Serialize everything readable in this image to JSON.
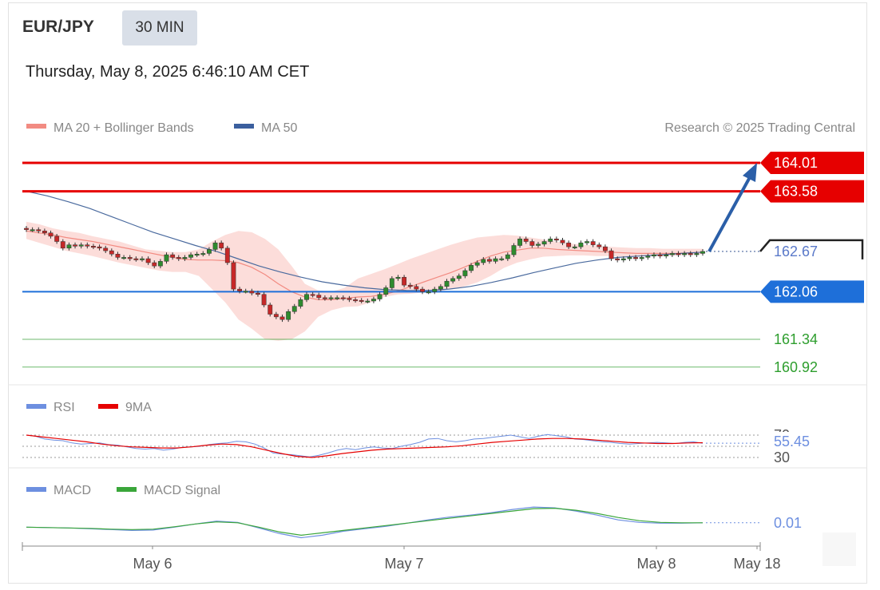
{
  "header": {
    "symbol": "EUR/JPY",
    "timeframe": "30 MIN",
    "datetime": "Thursday, May 8, 2025 6:46:10 AM CET"
  },
  "colors": {
    "resistance": "#e60000",
    "pivot": "#1e6fd9",
    "support": "#2e9e2e",
    "ma20": "#f28b82",
    "band_fill": "#fcd7d4",
    "ma50": "#4a6a9e",
    "arrow": "#2b5fa8",
    "candle_up": "#2e8b2e",
    "candle_down": "#c62828",
    "rsi": "#6d8fe0",
    "rsi_ma": "#e60000",
    "macd": "#6d8fe0",
    "macd_signal": "#3aa63a",
    "current": "#222222"
  },
  "chart_data": [
    {
      "type": "candlestick",
      "title": "EUR/JPY",
      "legend": [
        {
          "name": "MA 20 + Bollinger Bands",
          "color": "#f28b82"
        },
        {
          "name": "MA 50",
          "color": "#3b5f9e"
        }
      ],
      "credit": "Research © 2025 Trading Central",
      "ylim": [
        160.7,
        164.3
      ],
      "x_ticks": [
        "May 6",
        "May 7",
        "May 8",
        "May 18"
      ],
      "levels": [
        {
          "value": 164.01,
          "label": "164.01",
          "kind": "resistance"
        },
        {
          "value": 163.58,
          "label": "163.58",
          "kind": "resistance"
        },
        {
          "value": 162.67,
          "label": "162.67",
          "kind": "current"
        },
        {
          "value": 162.06,
          "label": "162.06",
          "kind": "pivot"
        },
        {
          "value": 161.34,
          "label": "161.34",
          "kind": "support"
        },
        {
          "value": 160.92,
          "label": "160.92",
          "kind": "support"
        }
      ],
      "close": [
        163.0,
        163.0,
        162.98,
        162.95,
        162.9,
        162.82,
        162.72,
        162.77,
        162.75,
        162.77,
        162.75,
        162.74,
        162.72,
        162.68,
        162.63,
        162.58,
        162.58,
        162.56,
        162.55,
        162.56,
        162.5,
        162.45,
        162.52,
        162.62,
        162.58,
        162.56,
        162.58,
        162.62,
        162.63,
        162.64,
        162.7,
        162.8,
        162.72,
        162.5,
        162.1,
        162.07,
        162.07,
        162.04,
        162.02,
        161.86,
        161.72,
        161.68,
        161.64,
        161.76,
        161.84,
        161.94,
        162.02,
        162.01,
        161.97,
        161.96,
        161.97,
        161.97,
        161.96,
        161.94,
        161.93,
        161.92,
        161.92,
        161.95,
        162.02,
        162.12,
        162.26,
        162.28,
        162.16,
        162.14,
        162.1,
        162.06,
        162.06,
        162.1,
        162.14,
        162.22,
        162.26,
        162.3,
        162.38,
        162.46,
        162.5,
        162.55,
        162.52,
        162.56,
        162.56,
        162.62,
        162.76,
        162.86,
        162.82,
        162.76,
        162.78,
        162.82,
        162.86,
        162.84,
        162.8,
        162.74,
        162.74,
        162.8,
        162.82,
        162.77,
        162.74,
        162.68,
        162.56,
        162.54,
        162.56,
        162.58,
        162.56,
        162.58,
        162.6,
        162.62,
        162.6,
        162.62,
        162.64,
        162.62,
        162.64,
        162.62,
        162.64,
        162.67
      ],
      "ma20": [
        162.98,
        162.95,
        162.92,
        162.88,
        162.85,
        162.82,
        162.78,
        162.74,
        162.7,
        162.66,
        162.62,
        162.58,
        162.55,
        162.54,
        162.54,
        162.53,
        162.5,
        162.43,
        162.32,
        162.18,
        162.06,
        161.98,
        161.94,
        161.94,
        161.96,
        161.98,
        161.99,
        162.02,
        162.07,
        162.14,
        162.21,
        162.28,
        162.35,
        162.43,
        162.52,
        162.6,
        162.66,
        162.69,
        162.72,
        162.72,
        162.7,
        162.69,
        162.68,
        162.67,
        162.66,
        162.65,
        162.64,
        162.64,
        162.64,
        162.64,
        162.65,
        162.66
      ],
      "bb_upper": [
        163.12,
        163.08,
        163.02,
        162.98,
        162.95,
        162.9,
        162.86,
        162.82,
        162.76,
        162.7,
        162.68,
        162.66,
        162.66,
        162.7,
        162.82,
        162.92,
        162.98,
        162.96,
        162.86,
        162.7,
        162.45,
        162.18,
        162.08,
        162.06,
        162.12,
        162.26,
        162.33,
        162.4,
        162.48,
        162.56,
        162.63,
        162.7,
        162.77,
        162.83,
        162.88,
        162.9,
        162.92,
        162.91,
        162.88,
        162.85,
        162.82,
        162.79,
        162.77,
        162.76,
        162.74,
        162.73,
        162.72,
        162.72,
        162.71,
        162.71,
        162.71,
        162.71
      ],
      "bb_lower": [
        162.86,
        162.8,
        162.74,
        162.68,
        162.64,
        162.6,
        162.55,
        162.5,
        162.46,
        162.42,
        162.38,
        162.36,
        162.36,
        162.3,
        162.1,
        161.9,
        161.64,
        161.5,
        161.34,
        161.32,
        161.34,
        161.46,
        161.68,
        161.78,
        161.83,
        161.84,
        161.9,
        161.98,
        162.02,
        162.03,
        162.05,
        162.06,
        162.1,
        162.14,
        162.2,
        162.3,
        162.42,
        162.5,
        162.55,
        162.59,
        162.6,
        162.61,
        162.61,
        162.6,
        162.6,
        162.59,
        162.59,
        162.6,
        162.6,
        162.61,
        162.62,
        162.63
      ],
      "ma50": [
        163.58,
        163.51,
        163.42,
        163.32,
        163.2,
        163.08,
        162.96,
        162.86,
        162.76,
        162.67,
        162.56,
        162.45,
        162.36,
        162.28,
        162.21,
        162.16,
        162.12,
        162.09,
        162.08,
        162.08,
        162.1,
        162.14,
        162.2,
        162.27,
        162.35,
        162.42,
        162.49,
        162.54,
        162.58,
        162.6,
        162.62,
        162.64,
        162.66
      ],
      "forecast": {
        "from": 162.67,
        "to": 164.01
      }
    },
    {
      "type": "line",
      "title": "RSI",
      "legend": [
        {
          "name": "RSI",
          "color": "#6d8fe0"
        },
        {
          "name": "9MA",
          "color": "#e60000"
        }
      ],
      "reference_lines": [
        "70",
        "30"
      ],
      "last_value": "55.45",
      "rsi": [
        70,
        68,
        63,
        61,
        60,
        56,
        54,
        55,
        56,
        53,
        52,
        49,
        46,
        45,
        46,
        43,
        45,
        48,
        49,
        50,
        53,
        55,
        56,
        59,
        58,
        54,
        47,
        38,
        36,
        35,
        33,
        31,
        34,
        38,
        43,
        46,
        44,
        47,
        49,
        47,
        46,
        50,
        53,
        57,
        63,
        64,
        60,
        58,
        60,
        63,
        64,
        66,
        68,
        70,
        67,
        64,
        68,
        71,
        69,
        67,
        63,
        62,
        60,
        58,
        57,
        55,
        54,
        55,
        56,
        57,
        56,
        55,
        57,
        58,
        55.45
      ],
      "rsi_9ma": [
        70,
        67,
        64,
        61,
        58,
        54,
        51,
        49,
        48,
        47,
        47,
        49,
        52,
        54,
        53,
        49,
        43,
        37,
        32,
        30,
        33,
        37,
        40,
        43,
        45,
        46,
        47,
        48,
        49,
        51,
        54,
        57,
        59,
        61,
        63,
        64,
        64,
        63,
        61,
        59,
        57,
        56,
        55,
        55,
        56,
        56.5
      ]
    },
    {
      "type": "line",
      "title": "MACD",
      "legend": [
        {
          "name": "MACD",
          "color": "#6d8fe0"
        },
        {
          "name": "MACD Signal",
          "color": "#3aa63a"
        }
      ],
      "last_value": "0.01",
      "macd": [
        -0.1,
        -0.11,
        -0.12,
        -0.14,
        -0.16,
        -0.18,
        -0.17,
        -0.1,
        -0.02,
        0.05,
        0.02,
        -0.12,
        -0.26,
        -0.36,
        -0.3,
        -0.2,
        -0.14,
        -0.08,
        0.0,
        0.08,
        0.15,
        0.2,
        0.26,
        0.34,
        0.4,
        0.38,
        0.3,
        0.2,
        0.08,
        0.02,
        0.0,
        0.0,
        0.01
      ],
      "macd_signal": [
        -0.1,
        -0.11,
        -0.12,
        -0.13,
        -0.15,
        -0.16,
        -0.15,
        -0.09,
        -0.02,
        0.03,
        0.01,
        -0.1,
        -0.22,
        -0.3,
        -0.24,
        -0.18,
        -0.12,
        -0.06,
        0.0,
        0.06,
        0.12,
        0.18,
        0.24,
        0.3,
        0.36,
        0.37,
        0.32,
        0.24,
        0.14,
        0.06,
        0.02,
        0.01,
        0.01
      ]
    }
  ]
}
